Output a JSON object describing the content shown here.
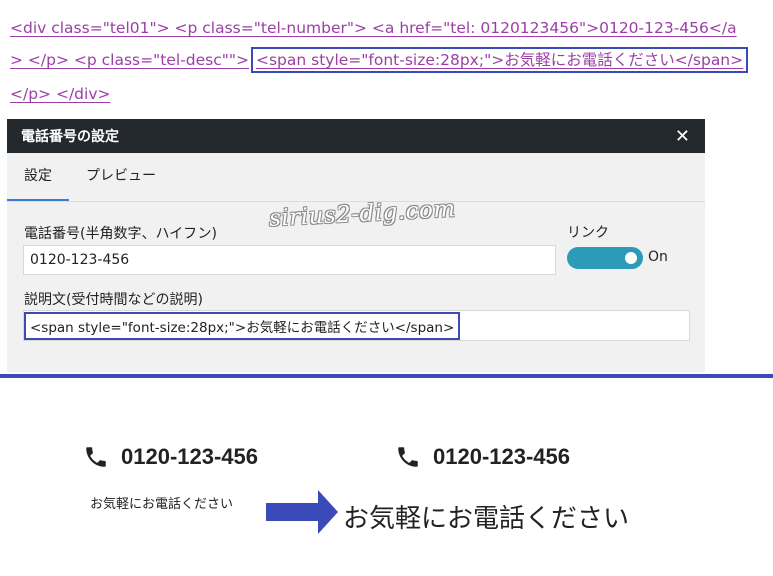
{
  "code": {
    "line1": "<div class=\"tel01\"> <p class=\"tel-number\"> <a href=\"tel: 0120123456\">0120-123-456</a",
    "line2_prefix": "> </p> <p class=\"tel-desc\"\">",
    "line2_boxed": "<span style=\"font-size:28px;\">お気軽にお電話ください</span>",
    "line3": "</p> </div>"
  },
  "dialog": {
    "title": "電話番号の設定",
    "close_glyph": "✕",
    "tabs": [
      {
        "label": "設定"
      },
      {
        "label": "プレビュー"
      }
    ],
    "watermark": "sirius2-dig.com",
    "phone_label": "電話番号(半角数字、ハイフン)",
    "phone_value": "0120-123-456",
    "link_label": "リンク",
    "toggle_state": "On",
    "desc_label": "説明文(受付時間などの説明)",
    "desc_value": "<span style=\"font-size:28px;\">お気軽にお電話ください</span>"
  },
  "preview": {
    "before_number": "0120-123-456",
    "before_desc": "お気軽にお電話ください",
    "after_number": "0120-123-456",
    "after_desc": "お気軽にお電話ください"
  },
  "colors": {
    "code_text": "#9b3fa6",
    "highlight_box": "#3a4ab8",
    "titlebar": "#23282d",
    "toggle": "#2b9bb8",
    "arrow": "#3a4ab8"
  }
}
